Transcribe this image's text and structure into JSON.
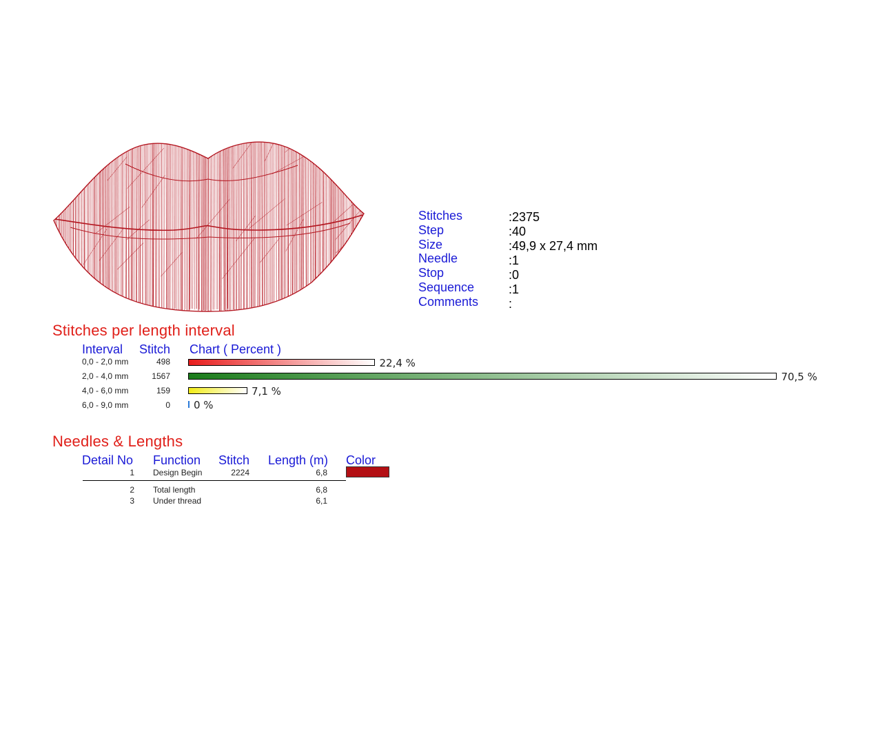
{
  "design_preview": {
    "thread_color": "#b3151f"
  },
  "info": {
    "rows": [
      {
        "label": "Stitches",
        "value": ":2375"
      },
      {
        "label": "Step",
        "value": ":40"
      },
      {
        "label": "Size",
        "value": ":49,9 x 27,4 mm"
      },
      {
        "label": "Needle",
        "value": ":1"
      },
      {
        "label": "Stop",
        "value": ":0"
      },
      {
        "label": "Sequence",
        "value": ":1"
      },
      {
        "label": "Comments",
        "value": ":"
      }
    ]
  },
  "stitches_section": {
    "title": "Stitches per length interval",
    "headers": {
      "interval": "Interval",
      "stitch": "Stitch",
      "chart": "Chart ( Percent )"
    },
    "rows": [
      {
        "interval": "0,0 - 2,0 mm",
        "stitch": "498",
        "percent": 22.4,
        "percent_label": "22,4 %",
        "color": "#e81c1c"
      },
      {
        "interval": "2,0 - 4,0 mm",
        "stitch": "1567",
        "percent": 70.5,
        "percent_label": "70,5 %",
        "color": "#1b7c1b"
      },
      {
        "interval": "4,0 - 6,0 mm",
        "stitch": "159",
        "percent": 7.1,
        "percent_label": "7,1 %",
        "color": "#f2ec18"
      },
      {
        "interval": "6,0 - 9,0 mm",
        "stitch": "0",
        "percent": 0,
        "percent_label": "0 %",
        "color": "#2a7ad8"
      }
    ]
  },
  "needles_section": {
    "title": "Needles & Lengths",
    "headers": {
      "detail_no": "Detail No",
      "function": "Function",
      "stitch": "Stitch",
      "length": "Length (m)",
      "color": "Color"
    },
    "rows": [
      {
        "detail_no": "1",
        "function": "Design Begin",
        "stitch": "2224",
        "length": "6,8",
        "color": "#b30f14"
      }
    ],
    "totals": [
      {
        "detail_no": "2",
        "function": "Total length",
        "length": "6,8"
      },
      {
        "detail_no": "3",
        "function": "Under thread",
        "length": "6,1"
      }
    ]
  }
}
